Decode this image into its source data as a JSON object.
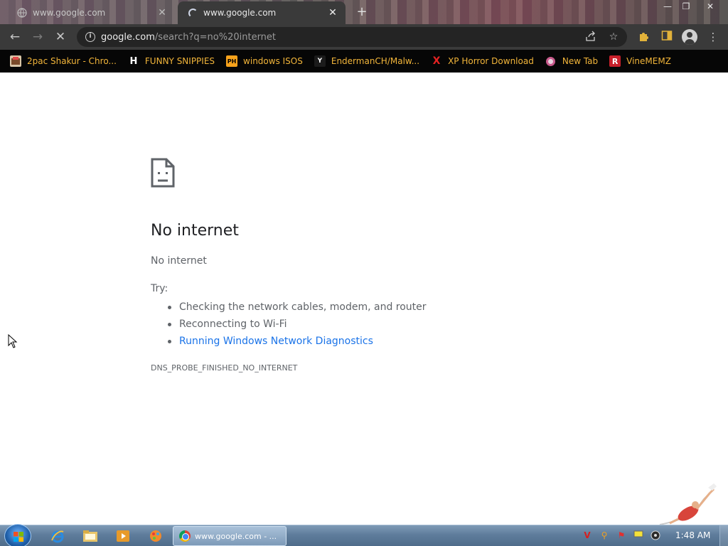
{
  "tabs": [
    {
      "title": "www.google.com",
      "state": "inactive"
    },
    {
      "title": "www.google.com",
      "state": "active-loading"
    }
  ],
  "toolbar": {
    "url_domain": "google.com",
    "url_path": "/search?q=no%20internet"
  },
  "bookmarks": [
    {
      "label": "2pac Shakur - Chro...",
      "icon": "2pac-favicon"
    },
    {
      "label": "FUNNY SNIPPIES",
      "icon": "h-favicon",
      "icon_text": "H"
    },
    {
      "label": "windows ISOS",
      "icon": "ph-favicon",
      "icon_text": "PH"
    },
    {
      "label": "EndermanCH/Malw...",
      "icon": "yp-favicon",
      "icon_text": "Y"
    },
    {
      "label": "XP Horror Download",
      "icon": "x-favicon",
      "icon_text": "X"
    },
    {
      "label": "New Tab",
      "icon": "globe-favicon"
    },
    {
      "label": "VineMEMZ",
      "icon": "r-favicon",
      "icon_text": "R"
    }
  ],
  "error_page": {
    "heading": "No internet",
    "subtitle": "No internet",
    "try_label": "Try:",
    "suggestions": [
      "Checking the network cables, modem, and router",
      "Reconnecting to Wi-Fi",
      "Running Windows Network Diagnostics"
    ],
    "error_code": "DNS_PROBE_FINISHED_NO_INTERNET"
  },
  "taskbar": {
    "active_task_label": "www.google.com - ...",
    "clock": "1:48 AM"
  },
  "colors": {
    "toolbar_bg": "#3a3a3a",
    "bookmark_text": "#f2b53a",
    "link_blue": "#1a73e8",
    "taskbar_blue": "#5f7d9c"
  }
}
